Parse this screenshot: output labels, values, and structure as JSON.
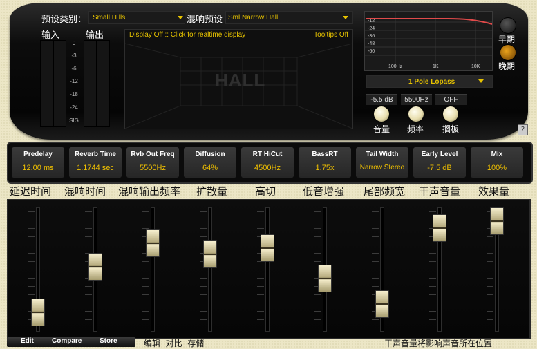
{
  "header": {
    "preset_category_label": "预设类别：",
    "preset_category_value": "Small H  lls",
    "reverb_preset_label": "混响预设",
    "reverb_preset_value": "Sml Narrow Hall"
  },
  "meters": {
    "input_label": "输入",
    "output_label": "输出",
    "scale": [
      "0",
      "-3",
      "-6",
      "-12",
      "-18",
      "-24",
      "SIG"
    ]
  },
  "display": {
    "status": "Display Off :: Click for realtime display",
    "tooltips": "Tooltips Off",
    "watermark": "HALL"
  },
  "eq": {
    "y_labels": [
      "-12",
      "-24",
      "-36",
      "-48",
      "-60"
    ],
    "x_labels": [
      "100Hz",
      "1K",
      "10K"
    ],
    "filter_value": "1 Pole Lopass",
    "level_value": "-5.5 dB",
    "freq_value": "5500Hz",
    "bypass_value": "OFF",
    "level_label": "音量",
    "freq_label": "频率",
    "bypass_label": "搁板"
  },
  "side": {
    "early_label": "早期",
    "late_label": "晚期",
    "help": "?"
  },
  "params": [
    {
      "name": "Predelay",
      "value": "12.00 ms",
      "cn": "延迟时间"
    },
    {
      "name": "Reverb Time",
      "value": "1.1744 sec",
      "cn": "混响时间"
    },
    {
      "name": "Rvb Out Freq",
      "value": "5500Hz",
      "cn": "混响输出频率"
    },
    {
      "name": "Diffusion",
      "value": "64%",
      "cn": "扩散量"
    },
    {
      "name": "RT HiCut",
      "value": "4500Hz",
      "cn": "高切"
    },
    {
      "name": "BassRT",
      "value": "1.75x",
      "cn": "低音增强"
    },
    {
      "name": "Tail Width",
      "value": "Narrow Stereo",
      "cn": "尾部频宽"
    },
    {
      "name": "Early Level",
      "value": "-7.5 dB",
      "cn": "干声音量"
    },
    {
      "name": "Mix",
      "value": "100%",
      "cn": "效果量"
    }
  ],
  "faders": [
    0.06,
    0.53,
    0.77,
    0.66,
    0.72,
    0.41,
    0.14,
    0.93,
    1.0
  ],
  "footer": {
    "edit": "Edit",
    "compare": "Compare",
    "store": "Store",
    "cn_buttons": "编辑  对比  存储",
    "note": "干声音量将影响声音所在位置"
  }
}
